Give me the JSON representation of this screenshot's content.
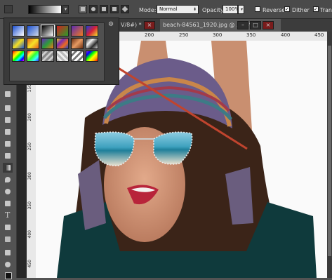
{
  "options_bar": {
    "mode_label": "Mode:",
    "mode_value": "Normal",
    "opacity_label": "Opacity:",
    "opacity_value": "100%",
    "reverse_label": "Reverse",
    "reverse_checked": false,
    "dither_label": "Dither",
    "dither_checked": true,
    "transparency_label": "Trans",
    "transparency_checked": true
  },
  "document_tabs": [
    {
      "label": "V/8#) *"
    },
    {
      "label": "beach-84561_1920.jpg @ 33.3% (RGB/8#)"
    }
  ],
  "ruler_top": [
    "200",
    "250",
    "300",
    "350",
    "400",
    "450"
  ],
  "ruler_left": [
    "100",
    "150",
    "200",
    "250",
    "300",
    "350",
    "400",
    "450"
  ],
  "window_buttons": [
    "×",
    "–",
    "□",
    "×"
  ],
  "gradient_presets": {
    "swatches": [
      [
        "fg-to-bg",
        "fg-to-transparent",
        "black-white",
        "red-green",
        "violet-orange",
        "blue-red-yellow"
      ],
      [
        "blue-yellow-blue",
        "orange-yellow-orange",
        "violet-green-orange",
        "yellow-violet-orange-blue",
        "copper",
        "chrome"
      ],
      [
        "spectrum",
        "transparent-rainbow",
        "transparent-stripes",
        "checker-transparent",
        "stripes",
        "rainbow"
      ]
    ],
    "selected": "black-white"
  },
  "colors": {
    "panel_bg": "#535353",
    "dark_bg": "#3c3c3c",
    "drag_line": "#c0442e"
  }
}
